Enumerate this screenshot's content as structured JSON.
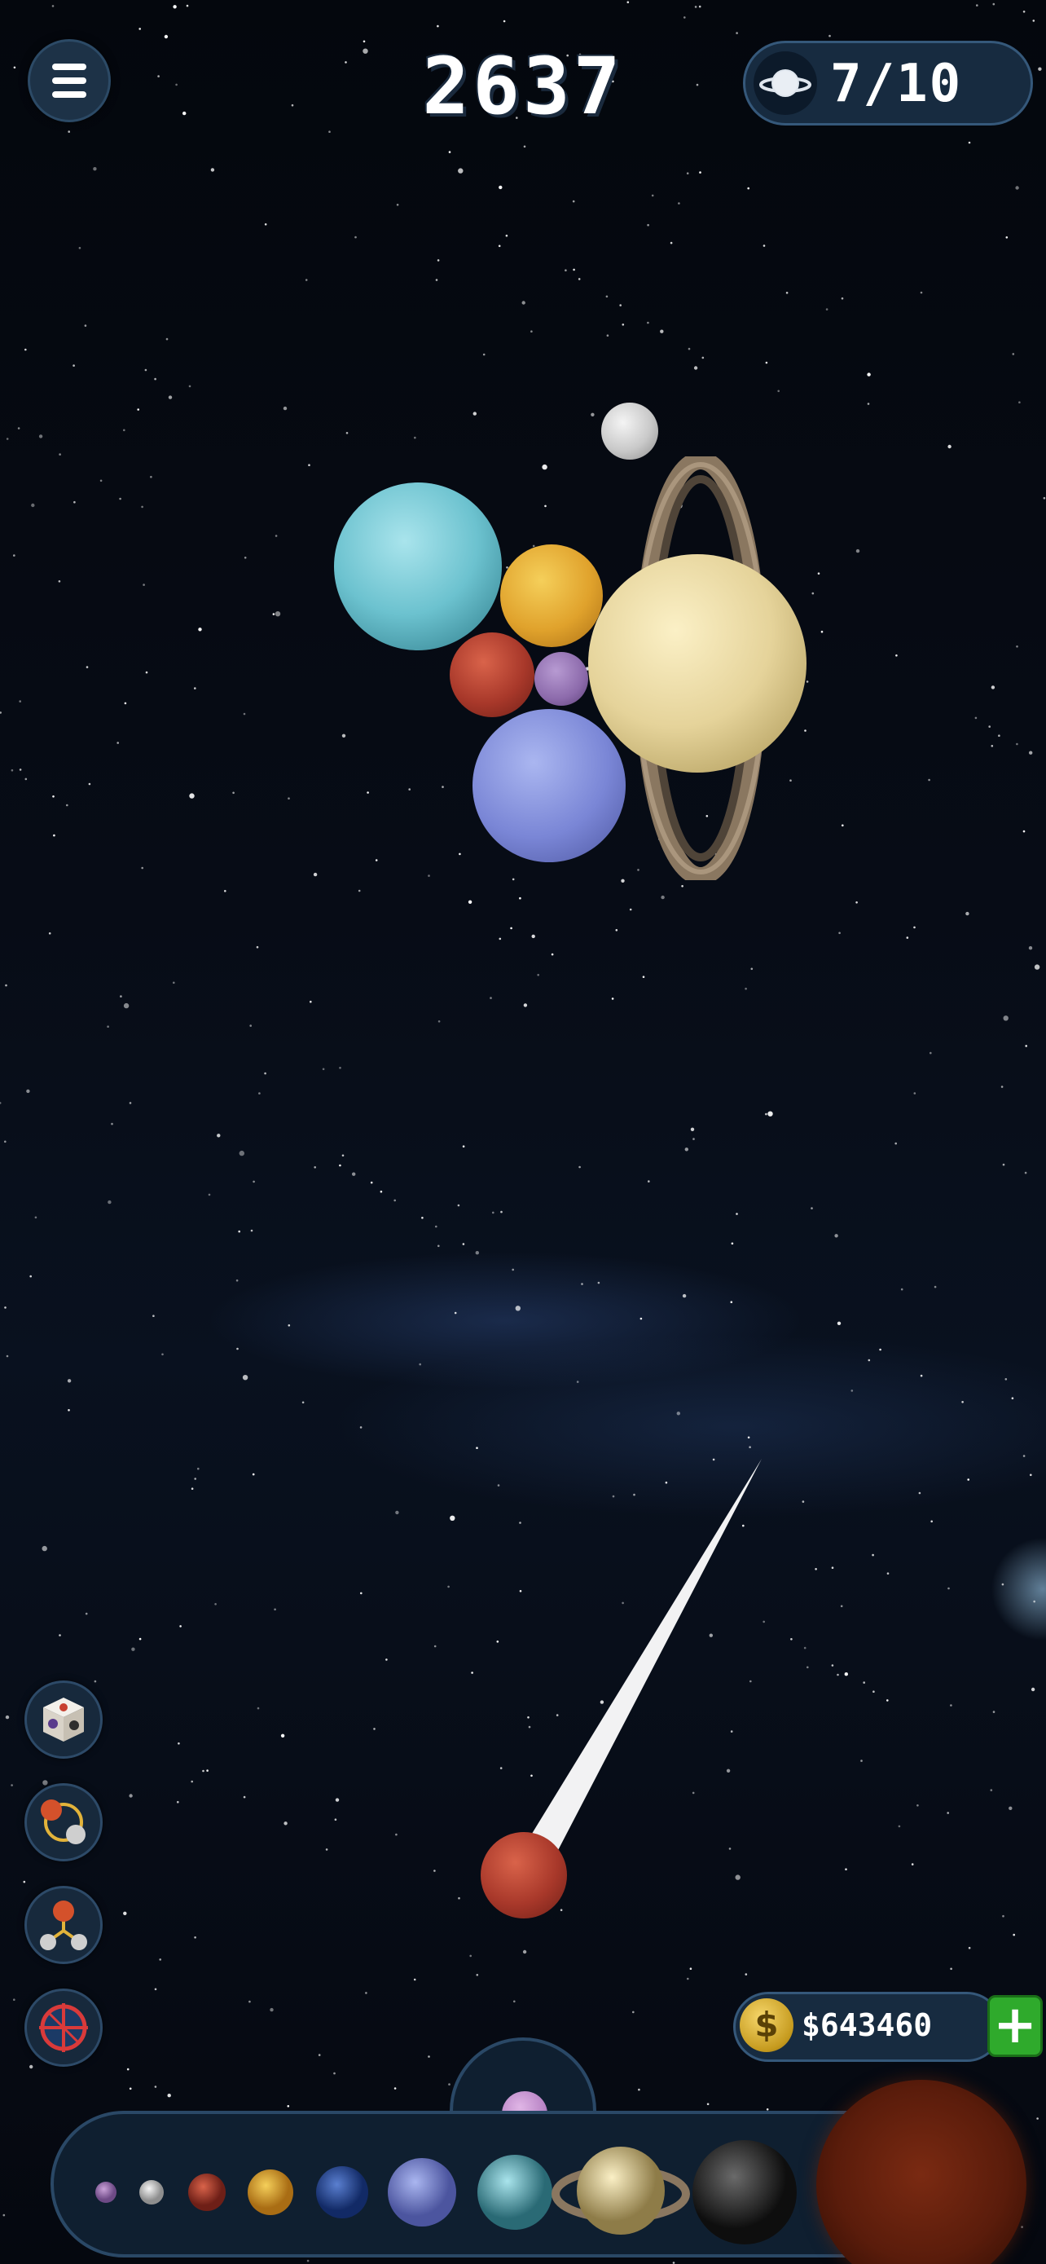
{
  "hud": {
    "menu_icon": "hamburger-menu-icon",
    "score": "2637",
    "planet_counter_icon": "ringed-planet-icon",
    "planet_counter": "7/10"
  },
  "field": {
    "planets": [
      "moon",
      "uranus",
      "venus",
      "saturn",
      "mars",
      "pluto",
      "neptune"
    ],
    "shooter": {
      "current_planet": "mars",
      "aim_icon": "aim-trail"
    },
    "next_planet": "pluto"
  },
  "side_tools": [
    {
      "name": "dice",
      "icon": "dice-icon"
    },
    {
      "name": "swap",
      "icon": "swap-planets-icon"
    },
    {
      "name": "split",
      "icon": "split-planet-icon"
    },
    {
      "name": "target",
      "icon": "target-crosshair-icon"
    }
  ],
  "wallet": {
    "coin_symbol": "$",
    "amount": "$643460",
    "add_label": "+"
  },
  "evolution_tray": {
    "planets": [
      "pluto",
      "moon",
      "mars",
      "venus",
      "earth",
      "neptune",
      "uranus",
      "saturn",
      "jupiter",
      "sun"
    ]
  }
}
